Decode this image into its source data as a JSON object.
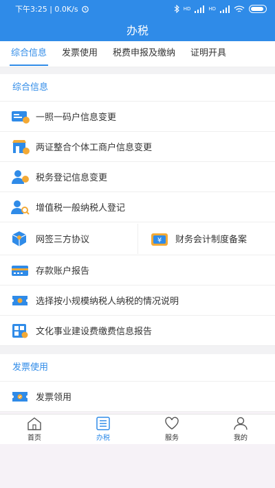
{
  "status": {
    "time_speed": "下午3:25 | 0.0K/s",
    "signal1": "HD",
    "signal2": "HD"
  },
  "title": "办税",
  "tabs": [
    "综合信息",
    "发票使用",
    "税费申报及缴纳",
    "证明开具"
  ],
  "section1": {
    "title": "综合信息",
    "items": [
      "一照一码户信息变更",
      "两证整合个体工商户信息变更",
      "税务登记信息变更",
      "增值税一般纳税人登记"
    ]
  },
  "split_row": {
    "left": "网签三方协议",
    "right": "财务会计制度备案"
  },
  "section1_more": [
    "存款账户报告",
    "选择按小规模纳税人纳税的情况说明",
    "文化事业建设费缴费信息报告"
  ],
  "section2": {
    "title": "发票使用",
    "items": [
      "发票领用"
    ]
  },
  "nav": [
    "首页",
    "办税",
    "服务",
    "我的"
  ],
  "colors": {
    "accent": "#2f8be8",
    "icon_orange": "#f3a935"
  }
}
